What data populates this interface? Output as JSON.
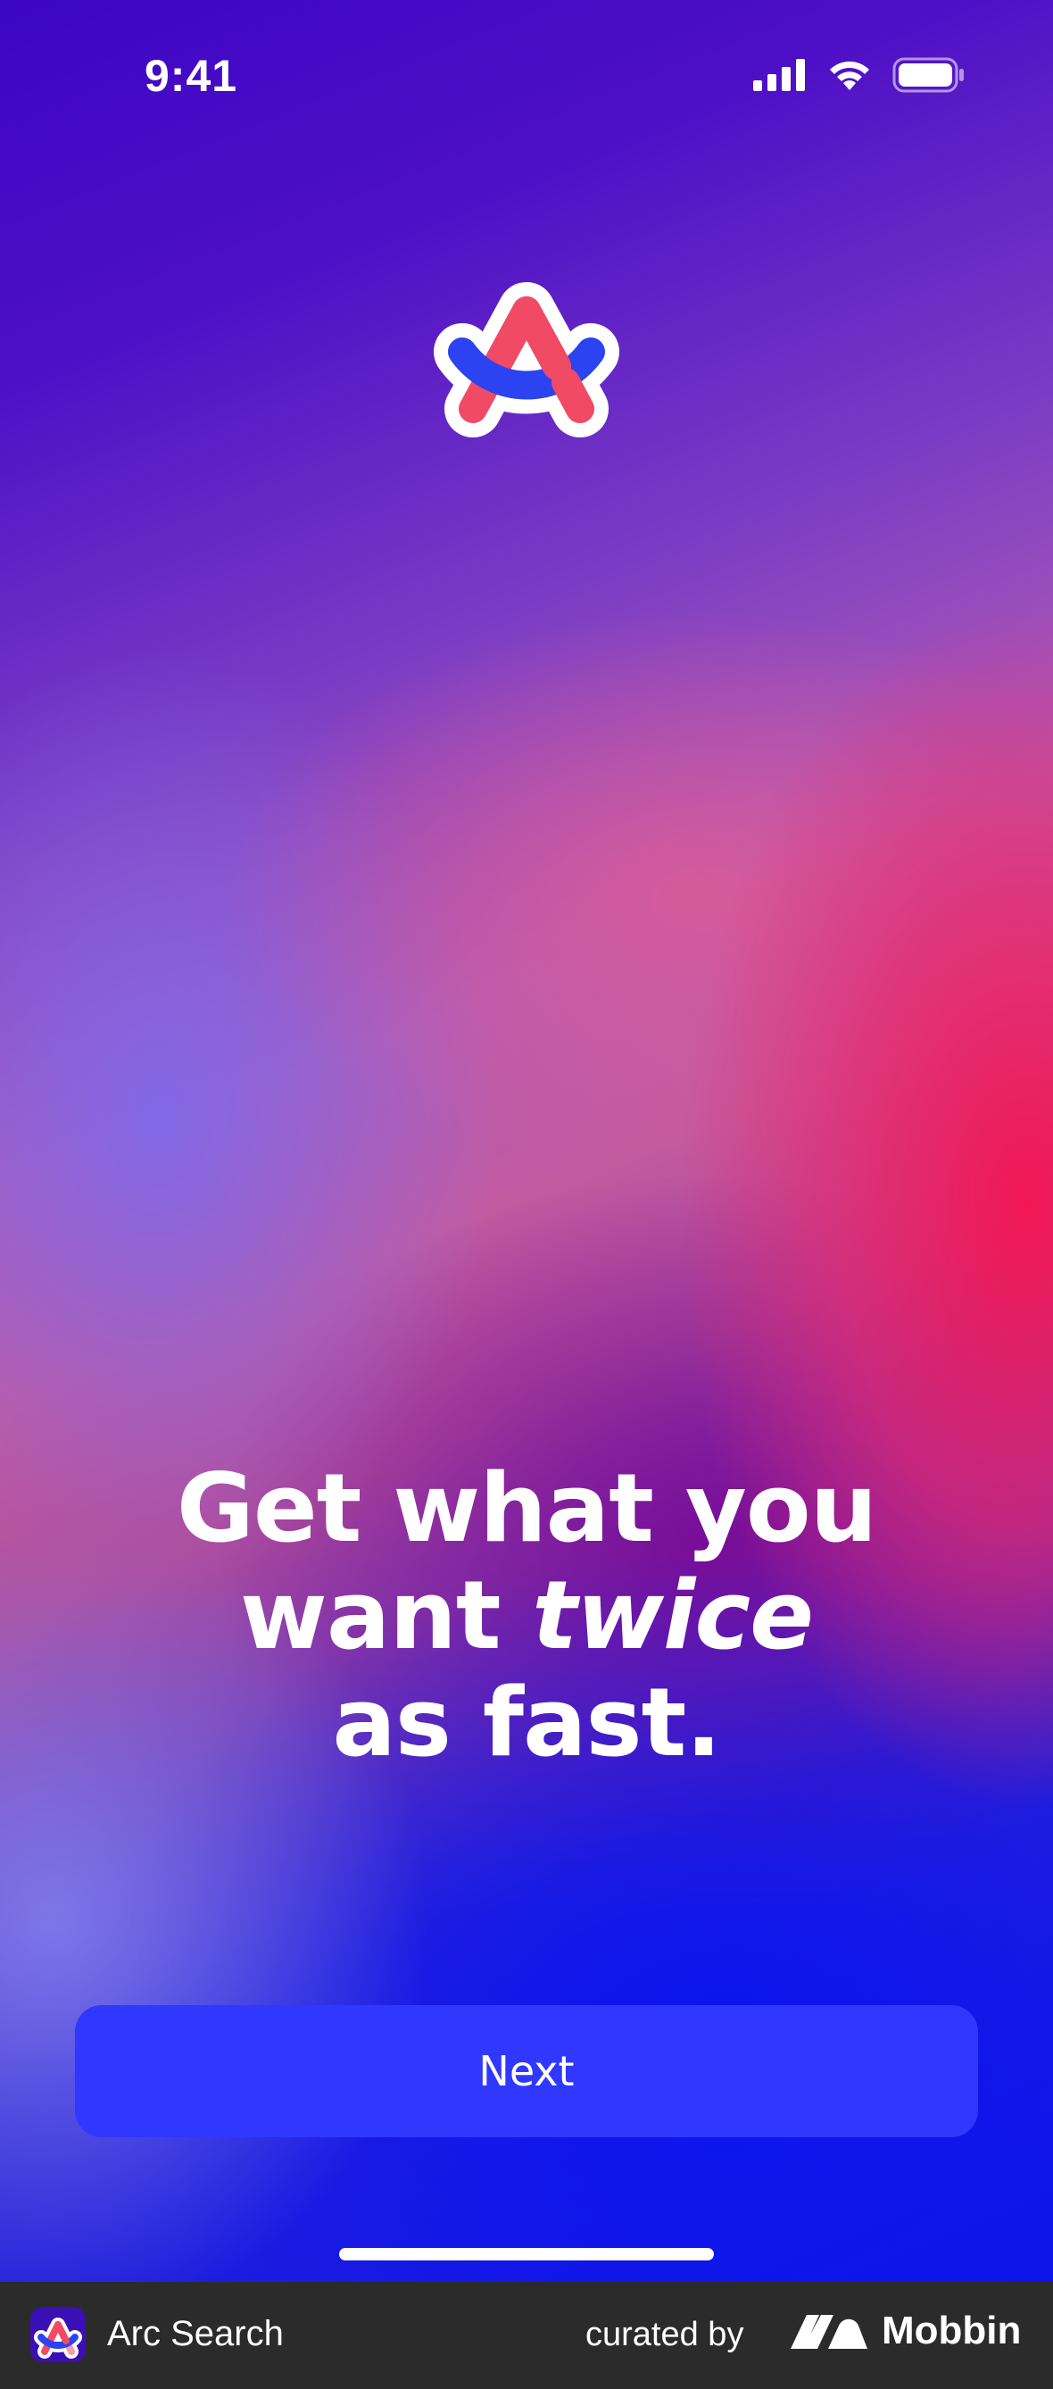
{
  "status_bar": {
    "time": "9:41",
    "icons": [
      "cellular-signal-icon",
      "wifi-icon",
      "battery-icon"
    ]
  },
  "app": {
    "logo_icon": "arc-logo-icon",
    "colors": {
      "accent_button": "#3038ff",
      "logo_red": "#f04a64",
      "logo_pink": "#f99aa8",
      "logo_blue": "#2b43f0"
    }
  },
  "headline": {
    "line1": "Get what you",
    "line2_prefix": "want ",
    "line2_emphasis": "twice",
    "line3": "as fast."
  },
  "actions": {
    "next_label": "Next"
  },
  "footer": {
    "app_name": "Arc Search",
    "curated_by": "curated by",
    "brand": "Mobbin",
    "brand_icon": "mobbin-logo-icon"
  }
}
